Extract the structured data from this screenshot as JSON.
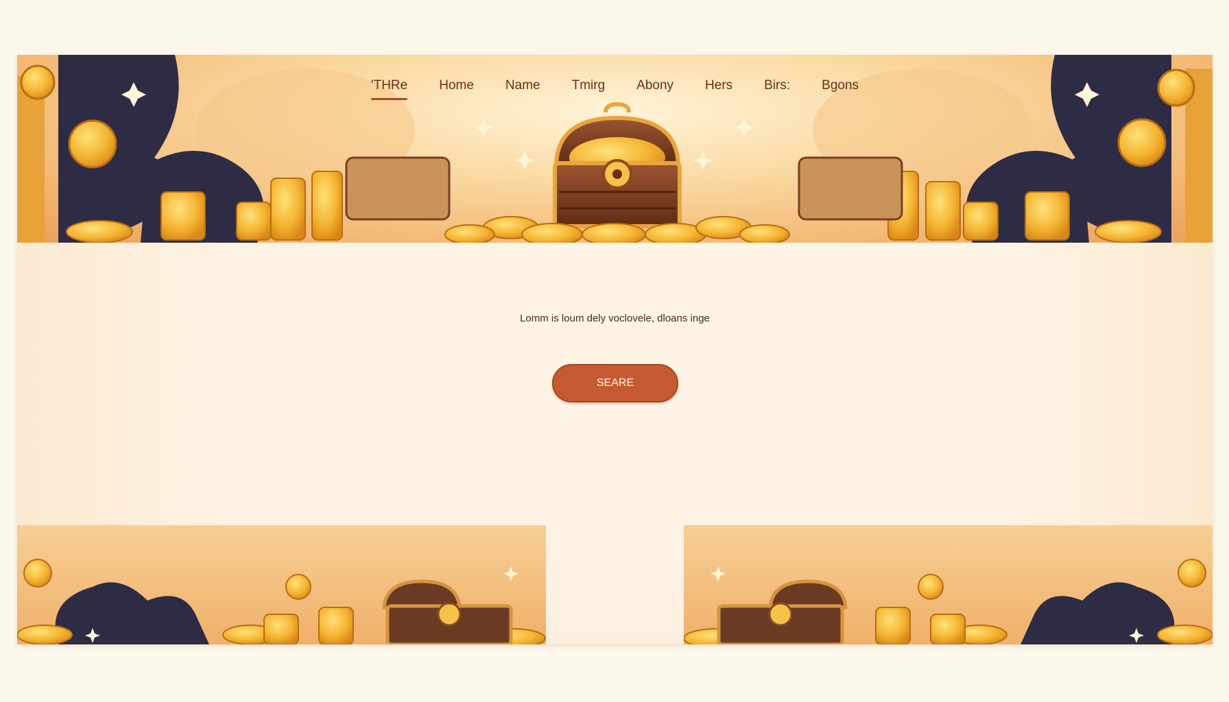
{
  "nav": {
    "items": [
      {
        "label": "'THRe",
        "active": true
      },
      {
        "label": "Home",
        "active": false
      },
      {
        "label": "Name",
        "active": false
      },
      {
        "label": "Tmirg",
        "active": false
      },
      {
        "label": "Abony",
        "active": false
      },
      {
        "label": "Hers",
        "active": false
      },
      {
        "label": "Birs:",
        "active": false
      },
      {
        "label": "Bgons",
        "active": false
      }
    ]
  },
  "hero": {
    "tagline": "Lomm is loum dely voclovele, dloans inge",
    "button_label": "SEARE"
  },
  "colors": {
    "accent": "#c65a30",
    "gold": "#f5b533",
    "chest": "#7a3e22",
    "foliage": "#2e2b45",
    "background": "#fdf1de"
  },
  "icons": [
    "treasure-chest-icon",
    "gold-coin-icon",
    "sparkle-icon"
  ]
}
